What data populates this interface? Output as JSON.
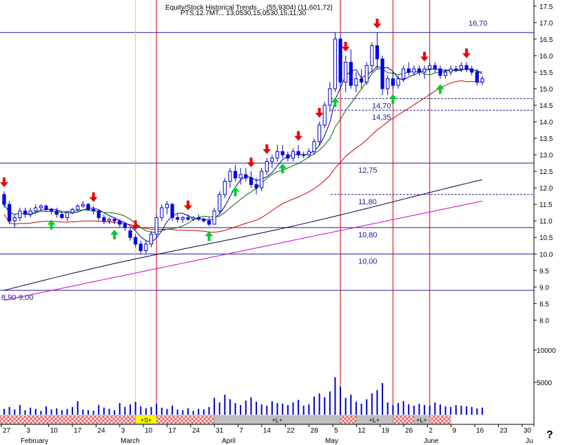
{
  "title": "Equity/Stock Historical Trends ... (55,9304) (11,601,72)",
  "subtitle": "PTS,12.7MT... 13,0530,15,0530,15,11,30",
  "help_icon": "?",
  "colors": {
    "bullish_candle": "#ffffff",
    "bearish_candle": "#0000ff",
    "ma_fast": "#00008b",
    "ma_medium": "#006400",
    "ma_slow": "#cc0000",
    "ma_long_black": "#000040",
    "ma_long_magenta": "#cc00cc",
    "level_line": "#1a1a9a",
    "signal_up_arrow": "#00cc33",
    "signal_down_arrow": "#ee0000",
    "event_line_red": "#cc0000",
    "event_line_yellow": "#ffcc00",
    "volume": "#0000cc",
    "band_buy": "#c0c0c0",
    "band_sell": "#ffdddd",
    "band_s": "#ffff00"
  },
  "chart_data": {
    "type": "candlestick",
    "y_axis": {
      "ticks": [
        "17.5",
        "17.0",
        "16.5",
        "16.0",
        "15.5",
        "15.0",
        "14.5",
        "14.0",
        "13.5",
        "13.0",
        "12.5",
        "12.0",
        "11.5",
        "11.0",
        "10.5",
        "10.0",
        "9.5",
        "9.0",
        "8.5",
        "8.0"
      ],
      "ylim": [
        7.8,
        17.6
      ]
    },
    "volume_axis": {
      "ticks": [
        "10000",
        "5000"
      ]
    },
    "x_axis": {
      "day_labels": [
        "27",
        "3",
        "10",
        "17",
        "24",
        "3",
        "10",
        "17",
        "24",
        "31",
        "7",
        "14",
        "22",
        "28",
        "5",
        "12",
        "19",
        "26",
        "2",
        "9",
        "16",
        "23",
        "30"
      ],
      "month_labels": [
        "February",
        "March",
        "April",
        "May",
        "June",
        "Ju"
      ]
    },
    "levels": [
      {
        "value": 16.7,
        "label": "16,70",
        "style": "solid"
      },
      {
        "value": 14.7,
        "label": "14,70",
        "style": "dashed"
      },
      {
        "value": 14.35,
        "label": "14,35",
        "style": "dashed"
      },
      {
        "value": 12.75,
        "label": "12,75",
        "style": "solid"
      },
      {
        "value": 11.8,
        "label": "11,80",
        "style": "dashed"
      },
      {
        "value": 10.8,
        "label": "10,80",
        "style": "solid"
      },
      {
        "value": 10.0,
        "label": "10,00",
        "style": "solid"
      },
      {
        "value": 8.9,
        "label": "8,90-9,00",
        "style": "solid"
      }
    ],
    "ohlc": [
      [
        11.8,
        11.9,
        11.4,
        11.5
      ],
      [
        11.5,
        11.6,
        10.9,
        11.0
      ],
      [
        11.0,
        11.2,
        10.8,
        11.1
      ],
      [
        11.1,
        11.4,
        11.0,
        11.3
      ],
      [
        11.3,
        11.4,
        11.1,
        11.2
      ],
      [
        11.2,
        11.4,
        11.1,
        11.3
      ],
      [
        11.3,
        11.5,
        11.2,
        11.4
      ],
      [
        11.4,
        11.5,
        11.3,
        11.45
      ],
      [
        11.45,
        11.5,
        11.3,
        11.35
      ],
      [
        11.35,
        11.4,
        11.2,
        11.3
      ],
      [
        11.3,
        11.4,
        11.1,
        11.2
      ],
      [
        11.2,
        11.3,
        11.05,
        11.1
      ],
      [
        11.1,
        11.3,
        11.0,
        11.25
      ],
      [
        11.25,
        11.4,
        11.2,
        11.35
      ],
      [
        11.35,
        11.5,
        11.3,
        11.45
      ],
      [
        11.45,
        11.6,
        11.4,
        11.5
      ],
      [
        11.5,
        11.55,
        11.3,
        11.35
      ],
      [
        11.35,
        11.45,
        11.2,
        11.3
      ],
      [
        11.3,
        11.35,
        11.0,
        11.1
      ],
      [
        11.1,
        11.2,
        10.9,
        11.0
      ],
      [
        11.0,
        11.1,
        10.9,
        11.05
      ],
      [
        11.05,
        11.1,
        10.9,
        11.0
      ],
      [
        11.0,
        11.05,
        10.8,
        10.9
      ],
      [
        10.9,
        10.95,
        10.7,
        10.8
      ],
      [
        10.7,
        10.8,
        10.4,
        10.5
      ],
      [
        10.5,
        10.6,
        10.2,
        10.3
      ],
      [
        10.3,
        10.4,
        10.0,
        10.1
      ],
      [
        10.1,
        10.4,
        10.0,
        10.3
      ],
      [
        10.3,
        10.7,
        10.2,
        10.6
      ],
      [
        10.6,
        11.2,
        10.5,
        11.1
      ],
      [
        11.1,
        11.5,
        11.0,
        11.4
      ],
      [
        11.4,
        11.6,
        11.2,
        11.5
      ],
      [
        11.5,
        11.55,
        11.0,
        11.1
      ],
      [
        11.1,
        11.2,
        10.95,
        11.05
      ],
      [
        11.05,
        11.15,
        10.95,
        11.1
      ],
      [
        11.1,
        11.2,
        11.0,
        11.05
      ],
      [
        11.05,
        11.15,
        11.0,
        11.1
      ],
      [
        11.1,
        11.2,
        11.0,
        11.05
      ],
      [
        11.05,
        11.1,
        10.95,
        11.0
      ],
      [
        11.0,
        11.1,
        10.85,
        10.9
      ],
      [
        10.9,
        11.4,
        10.9,
        11.3
      ],
      [
        11.3,
        11.9,
        11.2,
        11.8
      ],
      [
        11.8,
        12.3,
        11.7,
        12.2
      ],
      [
        12.2,
        12.6,
        12.0,
        12.5
      ],
      [
        12.5,
        12.7,
        12.2,
        12.3
      ],
      [
        12.3,
        12.6,
        12.1,
        12.4
      ],
      [
        12.4,
        12.6,
        12.2,
        12.3
      ],
      [
        12.3,
        12.5,
        12.0,
        12.1
      ],
      [
        12.1,
        12.3,
        11.8,
        12.0
      ],
      [
        12.0,
        12.6,
        11.9,
        12.5
      ],
      [
        12.5,
        12.9,
        12.4,
        12.8
      ],
      [
        12.8,
        13.0,
        12.6,
        12.9
      ],
      [
        12.9,
        13.3,
        12.8,
        13.1
      ],
      [
        13.1,
        13.3,
        12.9,
        13.0
      ],
      [
        13.0,
        13.1,
        12.8,
        12.9
      ],
      [
        12.9,
        13.2,
        12.8,
        13.1
      ],
      [
        13.1,
        13.3,
        12.9,
        13.0
      ],
      [
        13.0,
        13.1,
        12.9,
        13.0
      ],
      [
        13.0,
        13.2,
        12.9,
        13.1
      ],
      [
        13.1,
        13.5,
        13.0,
        13.4
      ],
      [
        13.4,
        14.0,
        13.3,
        13.9
      ],
      [
        13.9,
        14.6,
        13.8,
        14.5
      ],
      [
        14.5,
        15.2,
        14.3,
        15.0
      ],
      [
        15.0,
        16.7,
        14.9,
        16.5
      ],
      [
        16.5,
        16.6,
        15.0,
        15.2
      ],
      [
        15.2,
        16.0,
        14.9,
        15.8
      ],
      [
        15.8,
        16.2,
        15.0,
        15.1
      ],
      [
        15.1,
        15.5,
        14.9,
        15.3
      ],
      [
        15.3,
        15.6,
        15.0,
        15.2
      ],
      [
        15.2,
        15.8,
        15.1,
        15.7
      ],
      [
        15.7,
        16.4,
        15.5,
        16.3
      ],
      [
        16.3,
        16.7,
        15.6,
        15.9
      ],
      [
        15.9,
        16.0,
        14.8,
        15.0
      ],
      [
        15.0,
        15.4,
        14.8,
        15.3
      ],
      [
        15.3,
        15.5,
        15.0,
        15.1
      ],
      [
        15.1,
        15.4,
        15.0,
        15.3
      ],
      [
        15.3,
        15.7,
        15.2,
        15.6
      ],
      [
        15.6,
        15.8,
        15.4,
        15.5
      ],
      [
        15.5,
        15.7,
        15.4,
        15.6
      ],
      [
        15.6,
        15.7,
        15.4,
        15.5
      ],
      [
        15.5,
        15.7,
        15.3,
        15.6
      ],
      [
        15.6,
        15.8,
        15.5,
        15.7
      ],
      [
        15.7,
        15.8,
        15.5,
        15.6
      ],
      [
        15.6,
        15.7,
        15.3,
        15.4
      ],
      [
        15.4,
        15.6,
        15.3,
        15.5
      ],
      [
        15.5,
        15.7,
        15.4,
        15.6
      ],
      [
        15.6,
        15.7,
        15.5,
        15.6
      ],
      [
        15.6,
        15.8,
        15.5,
        15.7
      ],
      [
        15.7,
        15.8,
        15.5,
        15.6
      ],
      [
        15.6,
        15.7,
        15.4,
        15.5
      ],
      [
        15.5,
        15.6,
        15.1,
        15.2
      ],
      [
        15.2,
        15.4,
        15.1,
        15.3
      ]
    ],
    "volume": [
      900,
      1200,
      800,
      1500,
      700,
      1100,
      900,
      600,
      1300,
      800,
      1000,
      700,
      900,
      1200,
      2100,
      800,
      700,
      600,
      1500,
      1100,
      900,
      700,
      1800,
      1200,
      1600,
      2000,
      1300,
      1000,
      1200,
      1700,
      1100,
      900,
      1400,
      800,
      700,
      1000,
      600,
      900,
      800,
      1200,
      2600,
      1900,
      3100,
      2400,
      1800,
      1500,
      2200,
      2700,
      2000,
      1600,
      1400,
      2100,
      1800,
      1700,
      1500,
      1900,
      2300,
      1400,
      1600,
      2800,
      3300,
      2700,
      3600,
      5800,
      4300,
      2600,
      3100,
      2000,
      1700,
      2400,
      3300,
      3800,
      4900,
      1900,
      1500,
      1800,
      2100,
      1600,
      1400,
      1700,
      1500,
      1400,
      1900,
      1600,
      1300,
      1200,
      1500,
      1400,
      1300,
      1200,
      1000,
      1100
    ],
    "signals": [
      {
        "i": 0,
        "dir": "down"
      },
      {
        "i": 9,
        "dir": "up"
      },
      {
        "i": 17,
        "dir": "down"
      },
      {
        "i": 21,
        "dir": "up"
      },
      {
        "i": 25,
        "dir": "down"
      },
      {
        "i": 35,
        "dir": "down"
      },
      {
        "i": 39,
        "dir": "up"
      },
      {
        "i": 44,
        "dir": "up"
      },
      {
        "i": 47,
        "dir": "down"
      },
      {
        "i": 50,
        "dir": "down"
      },
      {
        "i": 53,
        "dir": "up"
      },
      {
        "i": 56,
        "dir": "down"
      },
      {
        "i": 60,
        "dir": "down"
      },
      {
        "i": 63,
        "dir": "up"
      },
      {
        "i": 65,
        "dir": "down"
      },
      {
        "i": 71,
        "dir": "down"
      },
      {
        "i": 74,
        "dir": "up"
      },
      {
        "i": 80,
        "dir": "down"
      },
      {
        "i": 83,
        "dir": "up"
      },
      {
        "i": 88,
        "dir": "down"
      }
    ],
    "event_lines": [
      {
        "i": 25,
        "color": "yellow"
      },
      {
        "i": 29,
        "color": "red"
      },
      {
        "i": 64,
        "color": "red"
      },
      {
        "i": 74,
        "color": "red"
      },
      {
        "i": 81,
        "color": "red"
      }
    ],
    "bands": [
      {
        "from": 0,
        "to": 25,
        "kind": "sell",
        "label": ""
      },
      {
        "from": 25,
        "to": 29,
        "kind": "s",
        "label": "+S+"
      },
      {
        "from": 29,
        "to": 40,
        "kind": "sell",
        "label": ""
      },
      {
        "from": 40,
        "to": 64,
        "kind": "buy",
        "label": "+L+"
      },
      {
        "from": 64,
        "to": 67,
        "kind": "sell",
        "label": ""
      },
      {
        "from": 67,
        "to": 74,
        "kind": "buy",
        "label": "+L+"
      },
      {
        "from": 74,
        "to": 78,
        "kind": "sell",
        "label": ""
      },
      {
        "from": 78,
        "to": 81,
        "kind": "buy",
        "label": "+L+"
      },
      {
        "from": 81,
        "to": 85,
        "kind": "sell",
        "label": ""
      }
    ]
  }
}
